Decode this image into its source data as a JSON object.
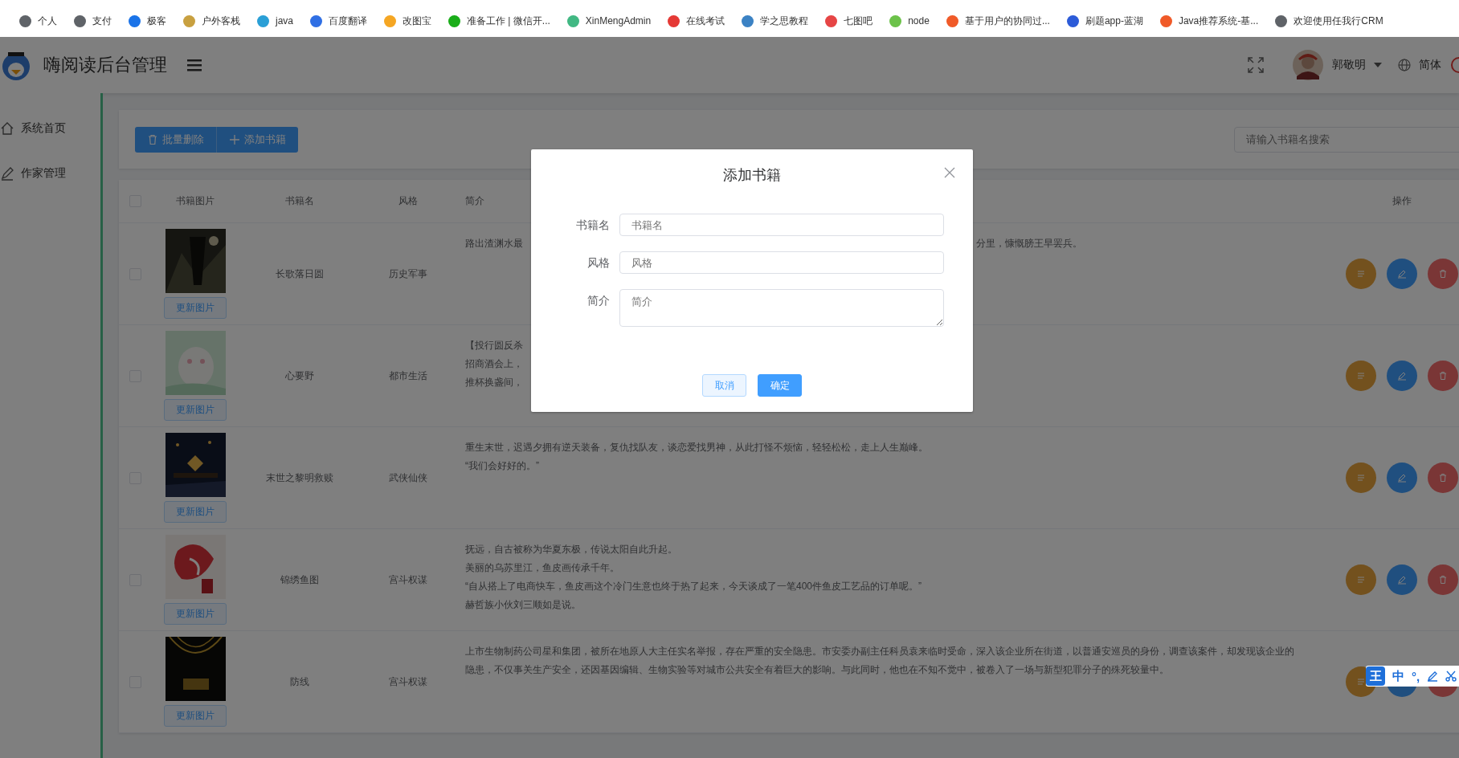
{
  "bookmarks": [
    {
      "label": "个人",
      "color": "#5f6368"
    },
    {
      "label": "支付",
      "color": "#5f6368"
    },
    {
      "label": "极客",
      "color": "#1a73e8"
    },
    {
      "label": "户外客栈",
      "color": "#c8a040"
    },
    {
      "label": "java",
      "color": "#2a9fd6"
    },
    {
      "label": "百度翻译",
      "color": "#2f6fe4"
    },
    {
      "label": "改图宝",
      "color": "#f5a623"
    },
    {
      "label": "准备工作 | 微信开...",
      "color": "#1aad19"
    },
    {
      "label": "XinMengAdmin",
      "color": "#41b883"
    },
    {
      "label": "在线考试",
      "color": "#e53935"
    },
    {
      "label": "学之思教程",
      "color": "#3b82c4"
    },
    {
      "label": "七图吧",
      "color": "#e64545"
    },
    {
      "label": "node",
      "color": "#6cc24a"
    },
    {
      "label": "基于用户的协同过...",
      "color": "#f05a28"
    },
    {
      "label": "刷题app-蓝湖",
      "color": "#2c5bd8"
    },
    {
      "label": "Java推荐系统-基...",
      "color": "#f05a28"
    },
    {
      "label": "欢迎使用任我行CRM",
      "color": "#5f6368"
    }
  ],
  "header": {
    "title": "嗨阅读后台管理",
    "user": "郭敬明",
    "language": "简体"
  },
  "sidebar": {
    "items": [
      {
        "label": "系统首页",
        "kind": "home"
      },
      {
        "label": "作家管理",
        "kind": "pen"
      }
    ]
  },
  "toolbar": {
    "buttons": [
      {
        "label": "批量删除",
        "kind": "delete"
      },
      {
        "label": "添加书籍",
        "kind": "plus"
      }
    ],
    "search": {
      "placeholder": "请输入书籍名搜索"
    }
  },
  "table": {
    "columns": [
      "书籍图片",
      "书籍名",
      "风格",
      "简介",
      "操作"
    ],
    "header_checked": false,
    "actions": [
      {
        "kind": "detail"
      },
      {
        "kind": "edit"
      },
      {
        "kind": "delete"
      }
    ],
    "rows": [
      {
        "checked": false,
        "cover_button": "更新图片",
        "name": "长歌落日圆",
        "style": "历史军事",
        "description": [
          {
            "left": "路出渣渊水最",
            "right": "分里，慷慨膀王早罢兵。"
          }
        ]
      },
      {
        "checked": false,
        "cover_button": "更新图片",
        "name": "心要野",
        "style": "都市生活",
        "description": [
          {
            "left": "【投行圆反杀"
          },
          {
            "left": "招商酒会上，"
          },
          {
            "left": "推杯换盏间，"
          }
        ]
      },
      {
        "checked": false,
        "cover_button": "更新图片",
        "name": "末世之黎明救赎",
        "style": "武侠仙侠",
        "description": [
          {
            "left": "重生末世，迟遇夕拥有逆天装备，复仇找队友，谈恋爱找男神，从此打怪不烦恼，轻轻松松，走上人生巅峰。"
          },
          {
            "left": "“我们会好好的。”"
          }
        ]
      },
      {
        "checked": false,
        "cover_button": "更新图片",
        "name": "锦绣鱼图",
        "style": "宫斗权谋",
        "description": [
          {
            "left": "抚远，自古被称为华夏东极，传说太阳自此升起。"
          },
          {
            "left": "美丽的乌苏里江，鱼皮画传承千年。"
          },
          {
            "left": "“自从搭上了电商快车，鱼皮画这个冷门生意也终于热了起来，今天谈成了一笔400件鱼皮工艺品的订单呢。”"
          },
          {
            "left": "赫哲族小伙刘三顺如是说。"
          }
        ]
      },
      {
        "checked": false,
        "cover_button": "更新图片",
        "name": "防线",
        "style": "宫斗权谋",
        "description": [
          {
            "left": "上市生物制药公司星和集团，被所在地原人大主任实名举报，存在严重的安全隐患。市安委办副主任科员袁来临时受命，深入该企业所在街道，以普通安巡员的身份，调查该案件，却发现该企业的"
          },
          {
            "left": "隐患，不仅事关生产安全，还因基因编辑、生物实验等对城市公共安全有着巨大的影响。与此同时，他也在不知不觉中，被卷入了一场与新型犯罪分子的殊死较量中。"
          }
        ]
      }
    ]
  },
  "dialog": {
    "title": "添加书籍",
    "fields": [
      {
        "label": "书籍名",
        "placeholder": "书籍名",
        "kind": "input"
      },
      {
        "label": "风格",
        "placeholder": "风格",
        "kind": "input"
      },
      {
        "label": "简介",
        "placeholder": "简介",
        "kind": "textarea"
      }
    ],
    "buttons": [
      {
        "label": "取消",
        "kind": "default"
      },
      {
        "label": "确定",
        "kind": "primary"
      }
    ]
  },
  "ime_toolbar": {
    "items": [
      {
        "kind": "logo",
        "label": "王"
      },
      {
        "kind": "text",
        "label": "中"
      },
      {
        "kind": "text",
        "label": "°,"
      },
      {
        "kind": "pen"
      },
      {
        "kind": "scissors"
      }
    ]
  }
}
